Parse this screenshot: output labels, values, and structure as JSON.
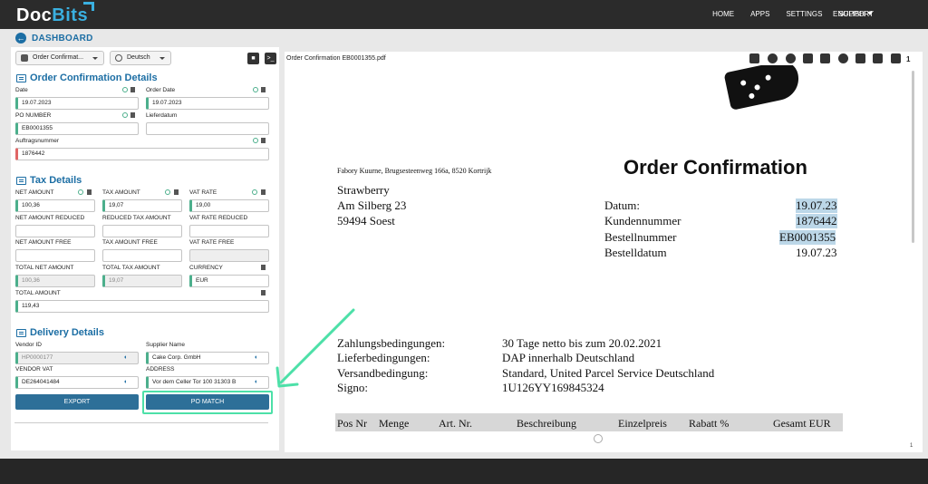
{
  "nav": {
    "brand_doc": "Doc",
    "brand_bits": "Bits",
    "items": [
      "HOME",
      "APPS",
      "SETTINGS",
      "SUPPORT"
    ],
    "language": "ENGLISH"
  },
  "breadcrumb": {
    "label": "DASHBOARD"
  },
  "toolbar": {
    "doc_type_select": "Order Confirmat...",
    "language_select": "Deutsch",
    "console_symbol": ">_"
  },
  "sections": {
    "order": "Order Confirmation Details",
    "tax": "Tax Details",
    "delivery": "Delivery Details"
  },
  "fields": {
    "date": {
      "label": "Date",
      "value": "19.07.2023"
    },
    "order_date": {
      "label": "Order Date",
      "value": "19.07.2023"
    },
    "po_number": {
      "label": "PO NUMBER",
      "value": "EB0001355"
    },
    "lieferdatum": {
      "label": "Lieferdatum",
      "value": ""
    },
    "auftragsnummer": {
      "label": "Auftragsnummer",
      "value": "1876442"
    },
    "net_amount": {
      "label": "NET AMOUNT",
      "value": "100,36"
    },
    "tax_amount": {
      "label": "TAX AMOUNT",
      "value": "19,07"
    },
    "vat_rate": {
      "label": "VAT RATE",
      "value": "19,00"
    },
    "net_amount_reduced": {
      "label": "NET AMOUNT REDUCED",
      "value": ""
    },
    "reduced_tax_amount": {
      "label": "REDUCED TAX AMOUNT",
      "value": ""
    },
    "vat_rate_reduced": {
      "label": "VAT RATE REDUCED",
      "value": ""
    },
    "net_amount_free": {
      "label": "NET AMOUNT FREE",
      "value": ""
    },
    "tax_amount_free": {
      "label": "TAX AMOUNT FREE",
      "value": ""
    },
    "vat_rate_free": {
      "label": "VAT RATE FREE",
      "value": ""
    },
    "total_net_amount": {
      "label": "TOTAL NET AMOUNT",
      "value": "100,36"
    },
    "total_tax_amount": {
      "label": "TOTAL TAX AMOUNT",
      "value": "19,07"
    },
    "currency": {
      "label": "CURRENCY",
      "value": "EUR"
    },
    "total_amount": {
      "label": "TOTAL AMOUNT",
      "value": "119,43"
    },
    "vendor_id": {
      "label": "Vendor ID",
      "value": "HP0000177"
    },
    "supplier_name": {
      "label": "Supplier Name",
      "value": "Cake Corp. GmbH"
    },
    "vendor_vat": {
      "label": "VENDOR VAT",
      "value": "DE264041484"
    },
    "address": {
      "label": "ADDRESS",
      "value": "Vor dem Celler Tor 100 31303 B"
    }
  },
  "actions": {
    "export": "EXPORT",
    "po_match": "PO MATCH"
  },
  "viewer": {
    "filename": "Order Confirmation EB0001355.pdf",
    "page_count": "1",
    "page_number": "1",
    "tools": [
      "presentation-icon",
      "zoom-in-icon",
      "zoom-out-icon",
      "search-doc-icon",
      "toggle-icon",
      "zoom-fit-icon",
      "layout-grid-icon",
      "layout-split-icon",
      "pages-icon"
    ]
  },
  "document": {
    "sender_line": "Fabory Kuurne, Brugsesteenweg 166a, 8520 Kortrijk",
    "heading": "Order Confirmation",
    "recipient": [
      "Strawberry",
      "Am Silberg 23",
      "59494 Soest"
    ],
    "meta": [
      {
        "label": "Datum:",
        "value": "19.07.23"
      },
      {
        "label": "Kundennummer",
        "value": "1876442"
      },
      {
        "label": "Bestellnummer",
        "value": "EB0001355"
      },
      {
        "label": "Bestelldatum",
        "value": "19.07.23"
      }
    ],
    "terms": [
      {
        "label": "Zahlungsbedingungen:",
        "value": "30 Tage netto bis zum 20.02.2021"
      },
      {
        "label": "Lieferbedingungen:",
        "value": "DAP innerhalb Deutschland"
      },
      {
        "label": "Versandbedingung:",
        "value": "Standard, United Parcel Service Deutschland"
      },
      {
        "label": "Signo:",
        "value": "1U126YY169845324"
      }
    ],
    "table_headers": [
      "Pos Nr",
      "Menge",
      "Art. Nr.",
      "Beschreibung",
      "Einzelpreis",
      "Rabatt %",
      "Gesamt EUR"
    ]
  },
  "colors": {
    "primary": "#2d6f98",
    "accent_link": "#1c6ea4",
    "valid": "#4caf8c",
    "invalid": "#e06666",
    "highlight": "#4de0a8"
  }
}
